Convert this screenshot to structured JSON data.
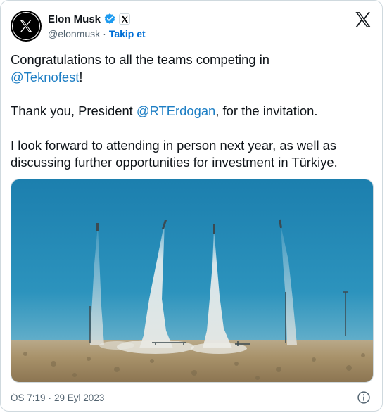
{
  "author": {
    "display_name": "Elon Musk",
    "handle": "@elonmusk",
    "separator": "·",
    "follow_label": "Takip et",
    "avatar_icon": "x-logo-icon",
    "verified_color": "#1d9bf0"
  },
  "tweet": {
    "line1_text": "Congratulations to all the teams competing in",
    "line1_mention": "@Teknofest",
    "line1_suffix": "!",
    "line2_prefix": "Thank you, President ",
    "line2_mention": "@RTErdogan",
    "line2_suffix": ", for the invitation.",
    "line3_text": "I look forward to attending in person next year, as well as discussing further opportunities for investment in Türkiye."
  },
  "media": {
    "kind": "photo",
    "subject": "rocket-launches"
  },
  "footer": {
    "time": "ÖS 7:19",
    "separator": "·",
    "date": "29 Eyl 2023"
  },
  "colors": {
    "link": "#1d7ec4",
    "follow": "#006fd6",
    "muted": "#536471",
    "text": "#0f1419",
    "border": "#cfd9de"
  }
}
